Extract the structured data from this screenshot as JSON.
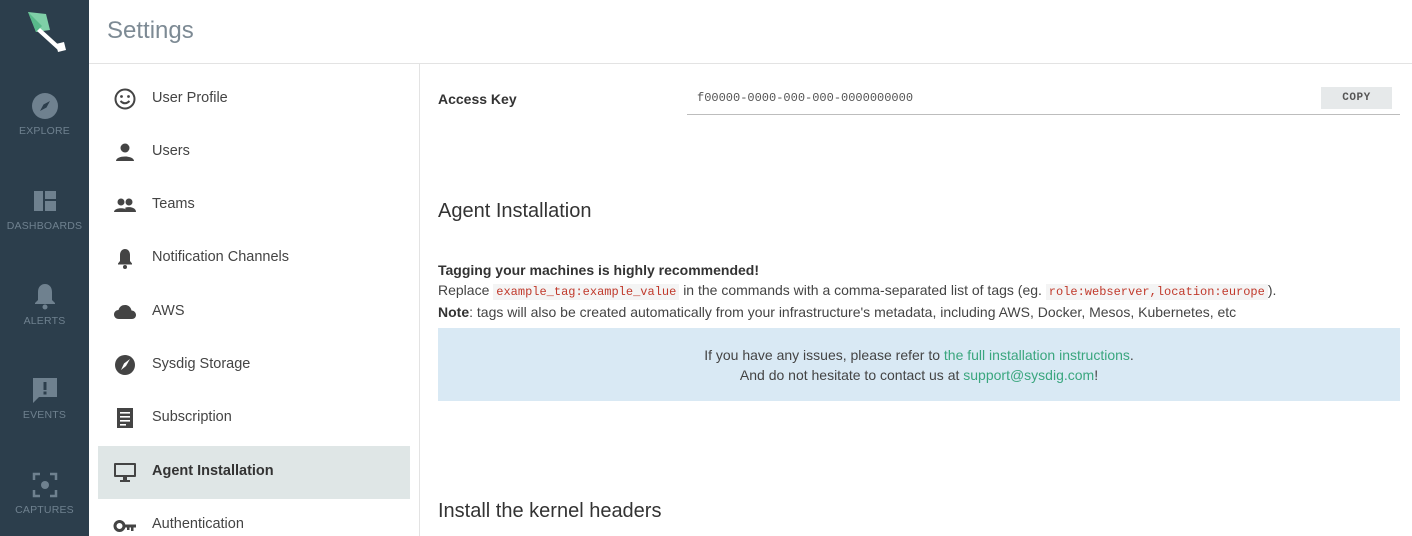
{
  "header": {
    "title": "Settings"
  },
  "rail": {
    "items": [
      {
        "label": "EXPLORE",
        "icon": "compass-icon"
      },
      {
        "label": "DASHBOARDS",
        "icon": "dashboard-icon"
      },
      {
        "label": "ALERTS",
        "icon": "bell-icon"
      },
      {
        "label": "EVENTS",
        "icon": "event-alert-icon"
      },
      {
        "label": "CAPTURES",
        "icon": "capture-icon"
      }
    ]
  },
  "nav": {
    "items": [
      {
        "label": "User Profile",
        "icon": "smiley-icon",
        "active": false
      },
      {
        "label": "Users",
        "icon": "person-icon",
        "active": false
      },
      {
        "label": "Teams",
        "icon": "group-icon",
        "active": false
      },
      {
        "label": "Notification Channels",
        "icon": "bell-icon",
        "active": false
      },
      {
        "label": "AWS",
        "icon": "cloud-icon",
        "active": false
      },
      {
        "label": "Sysdig Storage",
        "icon": "storage-icon",
        "active": false
      },
      {
        "label": "Subscription",
        "icon": "receipt-icon",
        "active": false
      },
      {
        "label": "Agent Installation",
        "icon": "monitor-icon",
        "active": true
      },
      {
        "label": "Authentication",
        "icon": "key-icon",
        "active": false
      }
    ]
  },
  "access_key": {
    "label": "Access Key",
    "value": "f00000-0000-000-000-0000000000",
    "copy_label": "COPY"
  },
  "agent_installation": {
    "heading": "Agent Installation",
    "tagging_title": "Tagging your machines is highly recommended!",
    "replace_prefix": "Replace",
    "example_tag": "example_tag:example_value",
    "replace_middle": "in the commands with a comma-separated list of tags (eg.",
    "example_tags": "role:webserver,location:europe",
    "replace_suffix": ").",
    "note_label": "Note",
    "note_text": ": tags will also be created automatically from your infrastructure's metadata, including AWS, Docker, Mesos, Kubernetes, etc"
  },
  "info_box": {
    "line1_prefix": "If you have any issues, please refer to ",
    "line1_link": "the full installation instructions",
    "line1_suffix": ".",
    "line2_prefix": "And do not hesitate to contact us at ",
    "line2_link": "support@sysdig.com",
    "line2_suffix": "!"
  },
  "kernel": {
    "heading": "Install the kernel headers"
  },
  "colors": {
    "rail_bg": "#2c3e4c",
    "active_bg": "#dfe6e6",
    "link": "#3aa67e",
    "info_bg": "#d9e9f4",
    "code_text": "#c0392b"
  }
}
